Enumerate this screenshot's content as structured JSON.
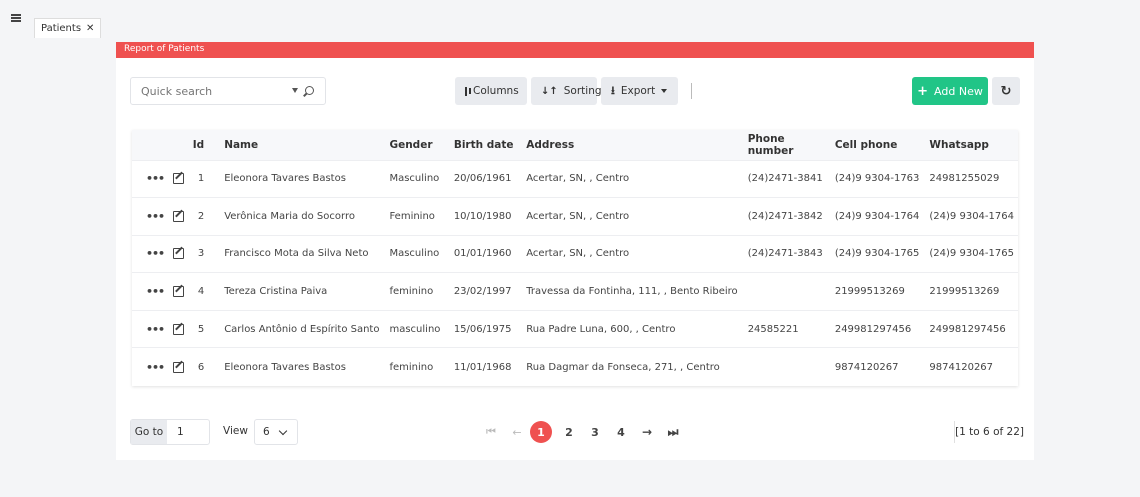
{
  "tabs": [
    {
      "label": "Patients"
    }
  ],
  "header": {
    "title": "Report of Patients"
  },
  "toolbar": {
    "search_placeholder": "Quick search",
    "columns_label": "Columns",
    "sorting_label": "Sorting",
    "export_label": "Export",
    "add_new_label": "Add New"
  },
  "table": {
    "headers": [
      "Id",
      "Name",
      "Gender",
      "Birth date",
      "Address",
      "Phone number",
      "Cell phone",
      "Whatsapp"
    ],
    "rows": [
      [
        "1",
        "Eleonora Tavares Bastos",
        "Masculino",
        "20/06/1961",
        "Acertar, SN, , Centro",
        "(24)2471-3841",
        "(24)9 9304-1763",
        "24981255029"
      ],
      [
        "2",
        "Verônica Maria do Socorro",
        "Feminino",
        "10/10/1980",
        "Acertar, SN, , Centro",
        "(24)2471-3842",
        "(24)9 9304-1764",
        "(24)9 9304-1764"
      ],
      [
        "3",
        "Francisco Mota da Silva Neto",
        "Masculino",
        "01/01/1960",
        "Acertar, SN, , Centro",
        "(24)2471-3843",
        "(24)9 9304-1765",
        "(24)9 9304-1765"
      ],
      [
        "4",
        "Tereza Cristina Paiva",
        "feminino",
        "23/02/1997",
        "Travessa da Fontinha, 111, , Bento Ribeiro",
        "",
        "21999513269",
        "21999513269"
      ],
      [
        "5",
        "Carlos Antônio d Espírito Santo",
        "masculino",
        "15/06/1975",
        "Rua Padre Luna, 600, , Centro",
        "24585221",
        "249981297456",
        "249981297456"
      ],
      [
        "6",
        "Eleonora Tavares Bastos",
        "feminino",
        "11/01/1968",
        "Rua Dagmar da Fonseca, 271, , Centro",
        "",
        "9874120267",
        "9874120267"
      ]
    ]
  },
  "footer": {
    "goto_label": "Go to",
    "goto_value": "1",
    "view_label": "View",
    "view_value": "6",
    "pages": [
      "1",
      "2",
      "3",
      "4"
    ],
    "current_page": "1",
    "count_label": "[1 to 6 of 22]"
  },
  "colors": {
    "accent": "#ef5150",
    "add_new": "#21c587"
  }
}
